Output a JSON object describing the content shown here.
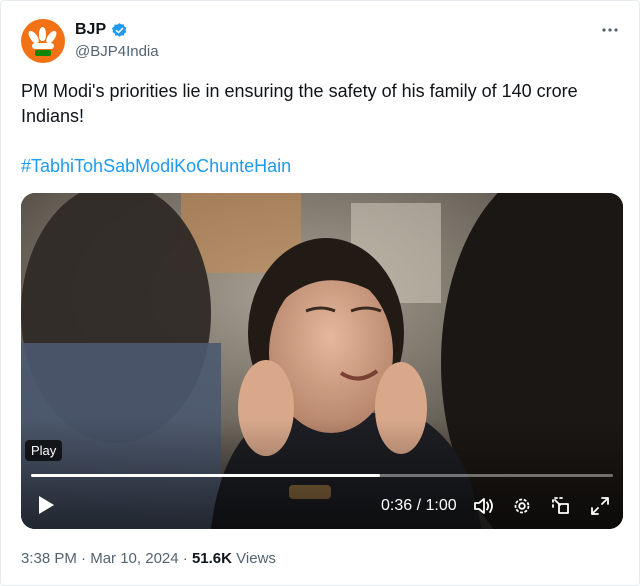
{
  "author": {
    "name": "BJP",
    "handle": "@BJP4India",
    "verified": true,
    "avatar_icon": "bjp-lotus-logo",
    "avatar_color": "#f47216"
  },
  "tweet": {
    "text": "PM Modi's priorities lie in ensuring the safety of his family of 140 crore Indians!",
    "hashtag": "#TabhiTohSabModiKoChunteHain"
  },
  "video": {
    "play_label": "Play",
    "current_time": "0:36",
    "duration": "1:00",
    "time_display": "0:36 / 1:00",
    "progress_fraction": 0.6,
    "controls": [
      "play-icon",
      "volume-icon",
      "settings-icon",
      "picture-in-picture-icon",
      "fullscreen-icon"
    ]
  },
  "meta": {
    "time": "3:38 PM",
    "separator": "·",
    "date": "Mar 10, 2024",
    "views_count": "51.6K",
    "views_label": "Views"
  },
  "menu_icon": "more-options-icon",
  "colors": {
    "link": "#1d9bf0",
    "muted": "#536471",
    "verified": "#1d9bf0"
  }
}
